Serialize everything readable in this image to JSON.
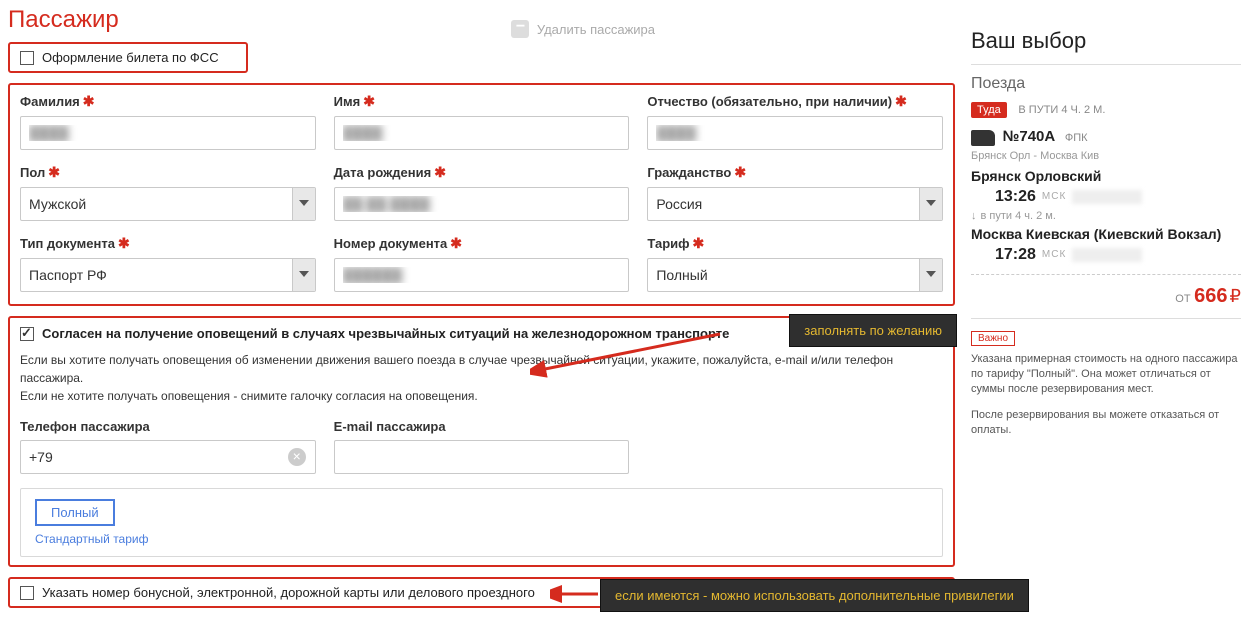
{
  "header": {
    "title": "Пассажир",
    "delete": "Удалить пассажира"
  },
  "fss": {
    "label": "Оформление билета по ФСС"
  },
  "form": {
    "lastname_label": "Фамилия",
    "firstname_label": "Имя",
    "patronymic_label": "Отчество (обязательно, при наличии)",
    "gender_label": "Пол",
    "gender_value": "Мужской",
    "dob_label": "Дата рождения",
    "citizenship_label": "Гражданство",
    "citizenship_value": "Россия",
    "doctype_label": "Тип документа",
    "doctype_value": "Паспорт РФ",
    "docnum_label": "Номер документа",
    "tariff_label": "Тариф",
    "tariff_value": "Полный"
  },
  "notify": {
    "consent": "Согласен на получение оповещений в случаях чрезвычайных ситуаций на железнодорожном транспорте",
    "info1": "Если вы хотите получать оповещения об изменении движения вашего поезда в случае чрезвычайной ситуации, укажите, пожалуйста, e-mail и/или телефон пассажира.",
    "info2": "Если не хотите получать оповещения - снимите галочку согласия на оповещения.",
    "phone_label": "Телефон пассажира",
    "phone_value": "+79",
    "email_label": "E-mail пассажира"
  },
  "tariffbox": {
    "selected": "Полный",
    "standard": "Стандартный тариф"
  },
  "bonus": {
    "label": "Указать номер бонусной, электронной, дорожной карты или делового проездного"
  },
  "anno": {
    "optional": "заполнять по желанию",
    "privileges": "если имеются - можно использовать дополнительные привилегии"
  },
  "side": {
    "title": "Ваш выбор",
    "trains": "Поезда",
    "direction": "Туда",
    "travel_time": "В ПУТИ 4 Ч. 2 М.",
    "train_no": "№740А",
    "carrier": "ФПК",
    "route": "Брянск Орл - Москва Кив",
    "from": "Брянск Орловский",
    "dep_time": "13:26",
    "enroute": "в пути  4 ч. 2 м.",
    "to": "Москва Киевская (Киевский Вокзал)",
    "arr_time": "17:28",
    "msk": "МСК",
    "price_from": "ОТ",
    "price": "666",
    "currency": "₽",
    "important": "Важно",
    "note1": "Указана примерная стоимость на одного пассажира по тарифу \"Полный\". Она может отличаться от суммы после резервирования мест.",
    "note2": "После резервирования вы можете отказаться от оплаты."
  }
}
